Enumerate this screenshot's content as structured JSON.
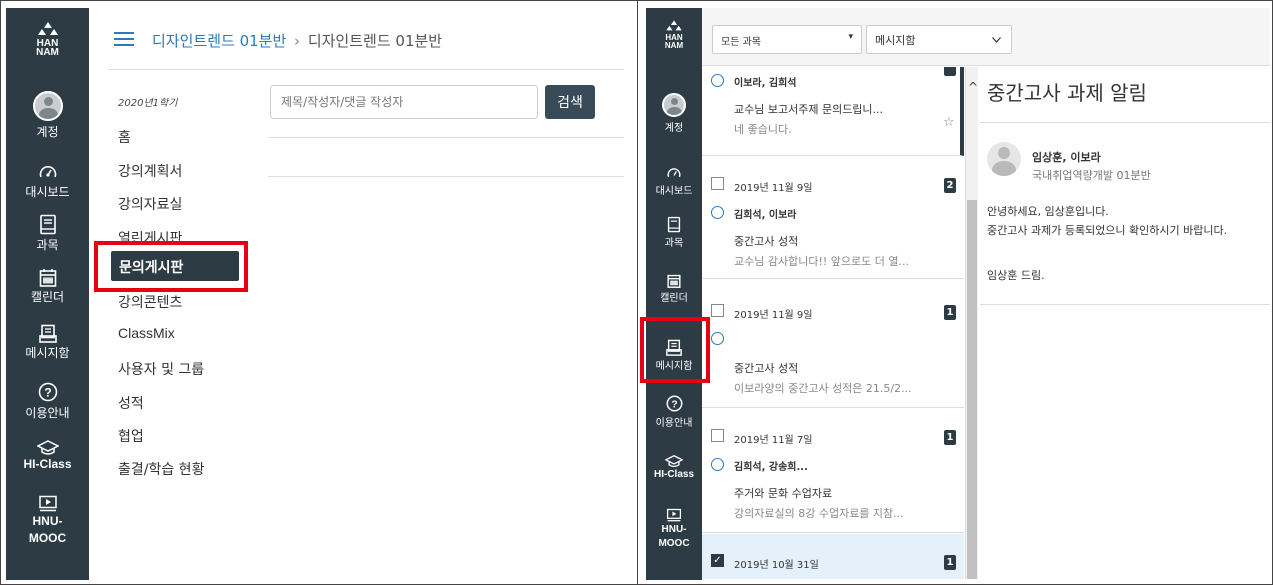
{
  "left": {
    "sidebar": {
      "logo_top": "HAN",
      "logo_bottom": "NAM",
      "items": [
        {
          "label": "계정",
          "icon": "account-avatar-icon"
        },
        {
          "label": "대시보드",
          "icon": "dashboard-icon"
        },
        {
          "label": "과목",
          "icon": "courses-icon"
        },
        {
          "label": "캘린더",
          "icon": "calendar-icon"
        },
        {
          "label": "메시지함",
          "icon": "inbox-icon"
        },
        {
          "label": "이용안내",
          "icon": "help-icon"
        },
        {
          "label": "HI-Class",
          "icon": "hi-class-icon"
        },
        {
          "label": "HNU-MOOC",
          "icon": "hnu-mooc-icon"
        }
      ]
    },
    "breadcrumb": {
      "course": "디자인트렌드 01분반",
      "separator": "›",
      "current": "디자인트렌드 01분반"
    },
    "term": "2020년1학기",
    "course_nav": [
      "홈",
      "강의계획서",
      "강의자료실",
      "열린게시판",
      "문의게시판",
      "강의콘텐츠",
      "ClassMix",
      "사용자 및 그룹",
      "성적",
      "협업",
      "출결/학습 현황"
    ],
    "search": {
      "placeholder": "제목/작성자/댓글 작성자",
      "button": "검색"
    }
  },
  "right": {
    "sidebar": {
      "logo_top": "HAN",
      "logo_bottom": "NAM",
      "items": [
        {
          "label": "계정",
          "icon": "account-avatar-icon"
        },
        {
          "label": "대시보드",
          "icon": "dashboard-icon"
        },
        {
          "label": "과목",
          "icon": "courses-icon"
        },
        {
          "label": "캘린더",
          "icon": "calendar-icon"
        },
        {
          "label": "메시지함",
          "icon": "inbox-icon"
        },
        {
          "label": "이용안내",
          "icon": "help-icon"
        },
        {
          "label": "HI-Class",
          "icon": "hi-class-icon"
        },
        {
          "label": "HNU-MOOC",
          "icon": "hnu-mooc-icon"
        }
      ]
    },
    "filters": {
      "course": "모든 과목",
      "folder": "메시지함"
    },
    "conversations": [
      {
        "date": "",
        "participants": "이보라, 김희석",
        "subject": "교수님 보고서주제 문의드립니...",
        "preview": "네 좋습니다.",
        "count": "",
        "checked": false
      },
      {
        "date": "2019년 11월 9일",
        "participants": "김희석, 이보라",
        "subject": "중간고사 성적",
        "preview": "교수님 감사합니다!! 앞으로도 더 열...",
        "count": "2",
        "checked": false
      },
      {
        "date": "2019년 11월 9일",
        "participants": "",
        "subject": "중간고사 성적",
        "preview": "이보라양의 중간고사 성적은 21.5/2...",
        "count": "1",
        "checked": false
      },
      {
        "date": "2019년 11월 7일",
        "participants": "김희석, 강송희...",
        "subject": "주거와 문화 수업자료",
        "preview": "강의자료실의 8강 수업자료를 지참...",
        "count": "1",
        "checked": false
      },
      {
        "date": "2019년 10월 31일",
        "participants": "",
        "subject": "",
        "preview": "",
        "count": "1",
        "checked": true
      }
    ],
    "message": {
      "title": "중간고사 과제 알림",
      "from": "임상훈, 이보라",
      "course": "국내취업역량개발 01분반",
      "body": [
        "안녕하세요, 임상훈입니다.",
        "중간고사 과제가 등록되었으니 확인하시기 바랍니다.",
        "임상훈 드림."
      ]
    }
  },
  "colors": {
    "sidebar": "#2d3b45",
    "link": "#2b7abc",
    "highlight": "#e60012",
    "selected_nav": "#2d3b45"
  }
}
